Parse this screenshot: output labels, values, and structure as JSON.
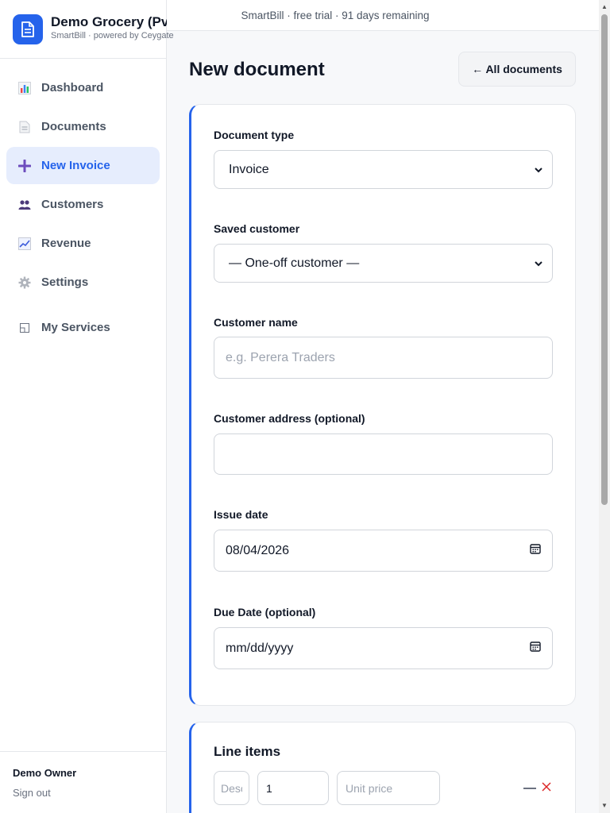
{
  "brand": {
    "name": "Demo Grocery (Pvt) Ltd",
    "subtitle": "SmartBill · powered by Ceygate",
    "accent": "#2563eb"
  },
  "trial_banner": "SmartBill · free trial · 91 days remaining",
  "sidebar": {
    "items": [
      {
        "label": "Dashboard",
        "icon": "bar-chart-icon",
        "active": false
      },
      {
        "label": "Documents",
        "icon": "document-icon",
        "active": false
      },
      {
        "label": "New Invoice",
        "icon": "plus-icon",
        "active": true
      },
      {
        "label": "Customers",
        "icon": "people-icon",
        "active": false
      },
      {
        "label": "Revenue",
        "icon": "trend-chart-icon",
        "active": false
      },
      {
        "label": "Settings",
        "icon": "gear-icon",
        "active": false
      },
      {
        "label": "My Services",
        "icon": "services-icon",
        "active": false
      }
    ],
    "user": "Demo Owner",
    "sign_out": "Sign out"
  },
  "header": {
    "title": "New document",
    "all_documents_button": "← All documents"
  },
  "form": {
    "document_type": {
      "label": "Document type",
      "value": "Invoice"
    },
    "saved_customer": {
      "label": "Saved customer",
      "value": "— One-off customer —"
    },
    "customer_name": {
      "label": "Customer name",
      "placeholder": "e.g. Perera Traders",
      "value": ""
    },
    "customer_address": {
      "label": "Customer address (optional)",
      "value": ""
    },
    "issue_date": {
      "label": "Issue date",
      "value": "08/04/2026"
    },
    "due_date": {
      "label": "Due Date (optional)",
      "value": "mm/dd/yyyy"
    }
  },
  "line_items": {
    "title": "Line items",
    "rows": [
      {
        "description_placeholder": "Description",
        "quantity": "1",
        "unit_price_placeholder": "Unit price"
      }
    ]
  }
}
